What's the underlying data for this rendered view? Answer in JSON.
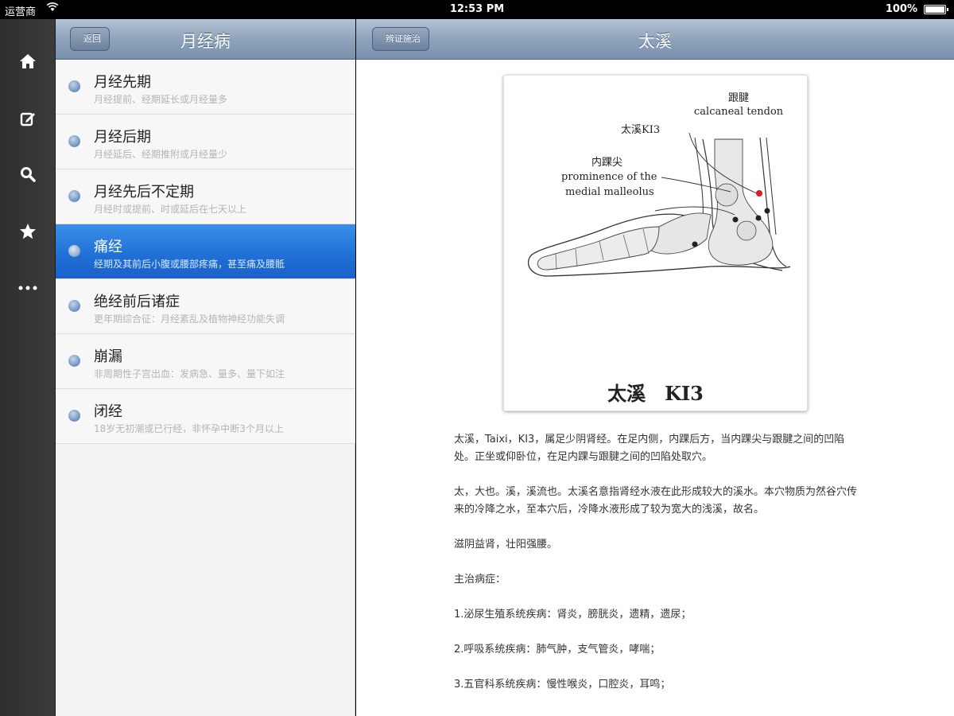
{
  "status": {
    "carrier": "运营商",
    "time": "12:53 PM",
    "battery": "100%"
  },
  "tabbar": {
    "items": [
      "home-icon",
      "compose-icon",
      "search-icon",
      "star-icon",
      "more-icon"
    ]
  },
  "master": {
    "back_label": "返回",
    "title": "月经病",
    "items": [
      {
        "title": "月经先期",
        "subtitle": "月经提前、经期延长或月经量多",
        "selected": false
      },
      {
        "title": "月经后期",
        "subtitle": "月经延后、经期推附或月经量少",
        "selected": false
      },
      {
        "title": "月经先后不定期",
        "subtitle": "月经时或提前、时或延后在七天以上",
        "selected": false
      },
      {
        "title": "痛经",
        "subtitle": "经期及其前后小腹或腰部疼痛，甚至痛及腰骶",
        "selected": true
      },
      {
        "title": "绝经前后诸症",
        "subtitle": "更年期综合征：月经紊乱及植物神经功能失调",
        "selected": false
      },
      {
        "title": "崩漏",
        "subtitle": "非周期性子宫出血：发病急、量多、量下如注",
        "selected": false
      },
      {
        "title": "闭经",
        "subtitle": "18岁无初潮或已行经，非怀孕中断3个月以上",
        "selected": false
      }
    ]
  },
  "detail": {
    "back_label": "辨证施治",
    "title": "太溪",
    "figure": {
      "label_tendon_cn": "跟腱",
      "label_tendon_en": "calcaneal tendon",
      "label_point": "太溪KI3",
      "label_malleolus_cn": "内踝尖",
      "label_malleolus_en1": "prominence of the",
      "label_malleolus_en2": "medial malleolus",
      "caption_cn": "太溪",
      "caption_en": "KI3"
    },
    "paragraphs": [
      "太溪，Taixi，KI3，属足少阴肾经。在足内侧，内踝后方，当内踝尖与跟腱之间的凹陷处。正坐或仰卧位，在足内踝与跟腱之间的凹陷处取穴。",
      "太，大也。溪，溪流也。太溪名意指肾经水液在此形成较大的溪水。本穴物质为然谷穴传来的冷降之水，至本穴后，冷降水液形成了较为宽大的浅溪，故名。",
      "滋阴益肾，壮阳强腰。",
      "主治病症：",
      "1.泌尿生殖系统疾病：肾炎，膀胱炎，遗精，遗尿；",
      "2.呼吸系统疾病：肺气肿，支气管炎，哮喘；",
      "3.五官科系统疾病：慢性喉炎，口腔炎，耳鸣；"
    ]
  },
  "colors": {
    "accent": "#1f6fd6",
    "navbar": "#8fa3bb",
    "point": "#e8141a"
  }
}
